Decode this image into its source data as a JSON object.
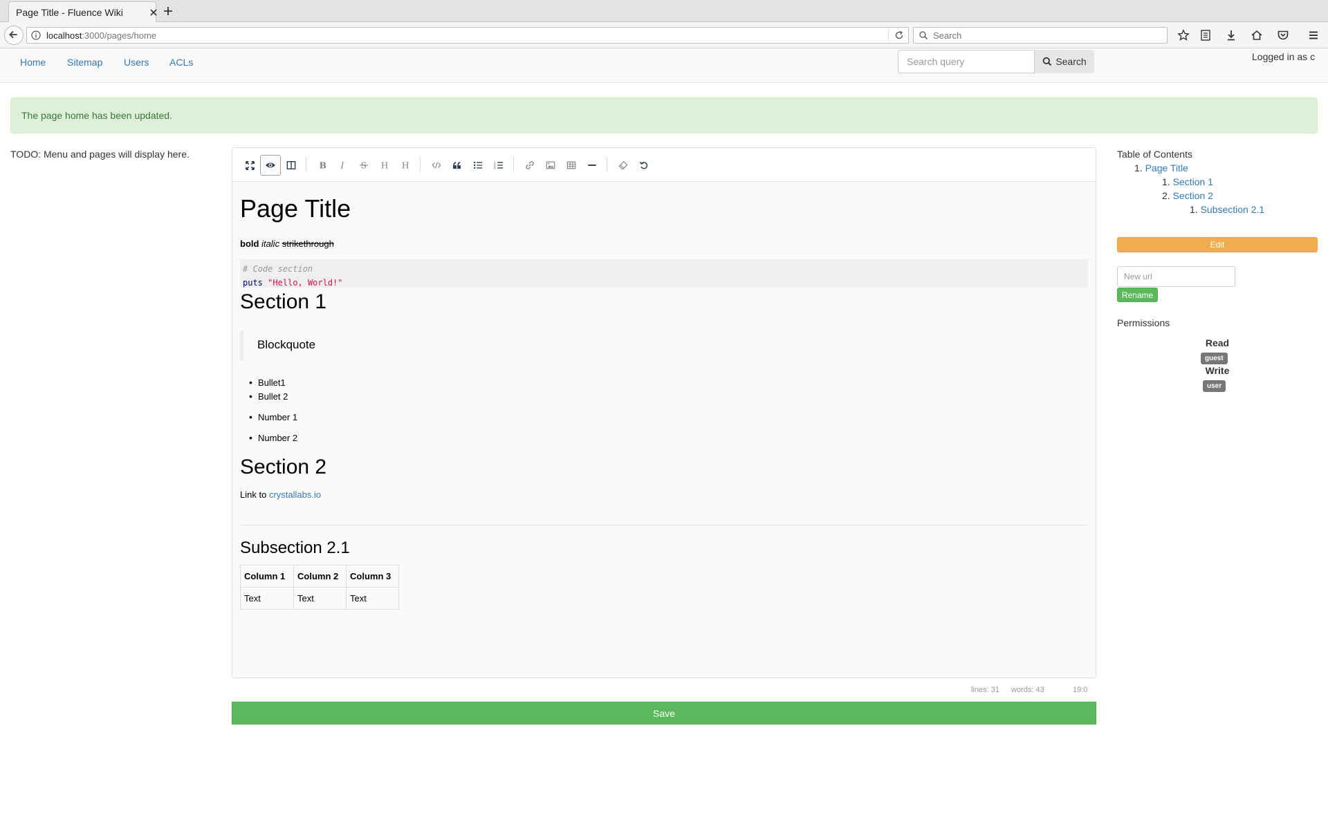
{
  "browser": {
    "tab_title": "Page Title - Fluence Wiki",
    "url_host": "localhost",
    "url_path": ":3000/pages/home",
    "search_placeholder": "Search"
  },
  "nav": {
    "links": [
      "Home",
      "Sitemap",
      "Users",
      "ACLs"
    ],
    "query_placeholder": "Search query",
    "search_button": "Search",
    "logged_in": "Logged in as c"
  },
  "alert": {
    "message": "The page home has been updated."
  },
  "sidebar_left": {
    "todo": "TODO: Menu and pages will display here."
  },
  "editor": {
    "toolbar_icons": [
      "fullscreen-icon",
      "preview-icon",
      "side-by-side-icon",
      "bold-icon",
      "italic-icon",
      "strikethrough-icon",
      "heading-icon",
      "heading-smaller-icon",
      "code-icon",
      "quote-icon",
      "unordered-list-icon",
      "ordered-list-icon",
      "link-icon",
      "image-icon",
      "table-icon",
      "horizontal-rule-icon",
      "clean-block-icon",
      "undo-icon"
    ],
    "preview": {
      "title": "Page Title",
      "bold": "bold",
      "italic": "italic",
      "strike": "strikethrough",
      "code_comment": "# Code section",
      "code_keyword": "puts",
      "code_string": "\"Hello, World!\"",
      "section1": "Section 1",
      "blockquote": "Blockquote",
      "bullets": [
        "Bullet1",
        "Bullet 2"
      ],
      "numbers": [
        "Number 1",
        "Number 2"
      ],
      "section2": "Section 2",
      "link_prefix": "Link to",
      "link_text": "crystallabs.io",
      "subsection": "Subsection 2.1",
      "table": {
        "headers": [
          "Column 1",
          "Column 2",
          "Column 3"
        ],
        "rows": [
          [
            "Text",
            "Text",
            "Text"
          ]
        ]
      }
    },
    "status": {
      "lines": "lines: 31",
      "words": "words: 43",
      "cursor": "19:0"
    },
    "save_label": "Save"
  },
  "sidebar_right": {
    "toc_title": "Table of Contents",
    "toc": [
      {
        "num": "1.",
        "label": "Page Title"
      },
      {
        "num": "1.",
        "label": "Section 1"
      },
      {
        "num": "2.",
        "label": "Section 2"
      },
      {
        "num": "1.",
        "label": "Subsection 2.1"
      }
    ],
    "edit_label": "Edit",
    "new_url_placeholder": "New url",
    "rename_label": "Rename",
    "permissions_title": "Permissions",
    "read_label": "Read",
    "read_badge": "guest",
    "write_label": "Write",
    "write_badge": "user"
  }
}
